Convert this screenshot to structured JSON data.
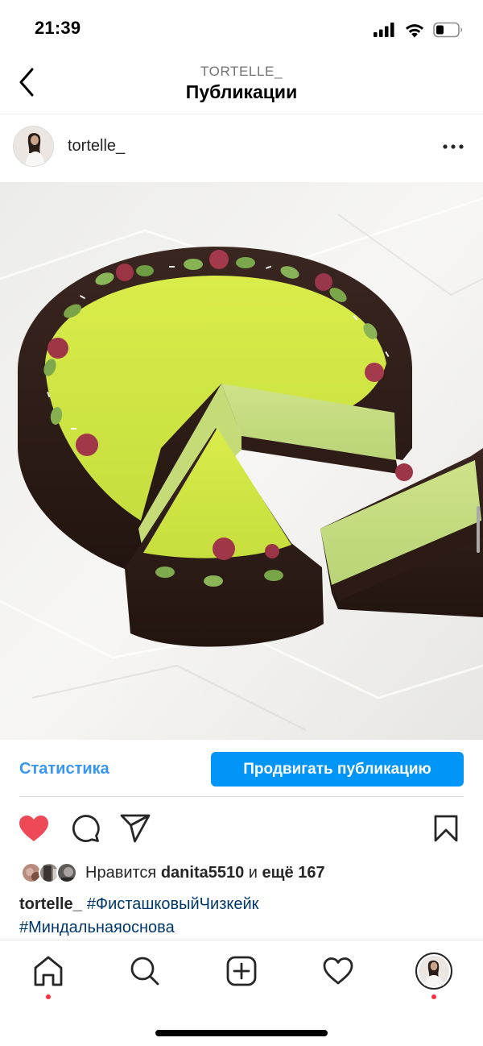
{
  "status_bar": {
    "time": "21:39"
  },
  "header": {
    "subtitle": "TORTELLE_",
    "title": "Публикации"
  },
  "post": {
    "username": "tortelle_",
    "stats_label": "Статистика",
    "promote_label": "Продвигать публикацию",
    "liked": true,
    "likes": {
      "prefix": "Нравится",
      "user": "danita5510",
      "conjunction": "и",
      "count_text": "ещё 167"
    },
    "caption": {
      "user": "tortelle_",
      "hashtags": [
        "#ФисташковыйЧизкейк",
        "#Миндальнаяоснова"
      ]
    }
  },
  "icons": {
    "status": [
      "signal-icon",
      "wifi-icon",
      "battery-icon"
    ],
    "header": [
      "back-chevron-icon",
      "more-dots-icon"
    ],
    "actions": [
      "heart-filled-icon",
      "comment-icon",
      "share-icon",
      "bookmark-icon"
    ],
    "tabs": [
      "home-icon",
      "search-icon",
      "create-icon",
      "activity-icon",
      "profile-avatar"
    ]
  },
  "colors": {
    "accent_blue": "#0095f6",
    "link_blue": "#3897f0",
    "hashtag_blue": "#00376b",
    "like_red": "#ed4956",
    "notification_dot": "#ff3040"
  }
}
